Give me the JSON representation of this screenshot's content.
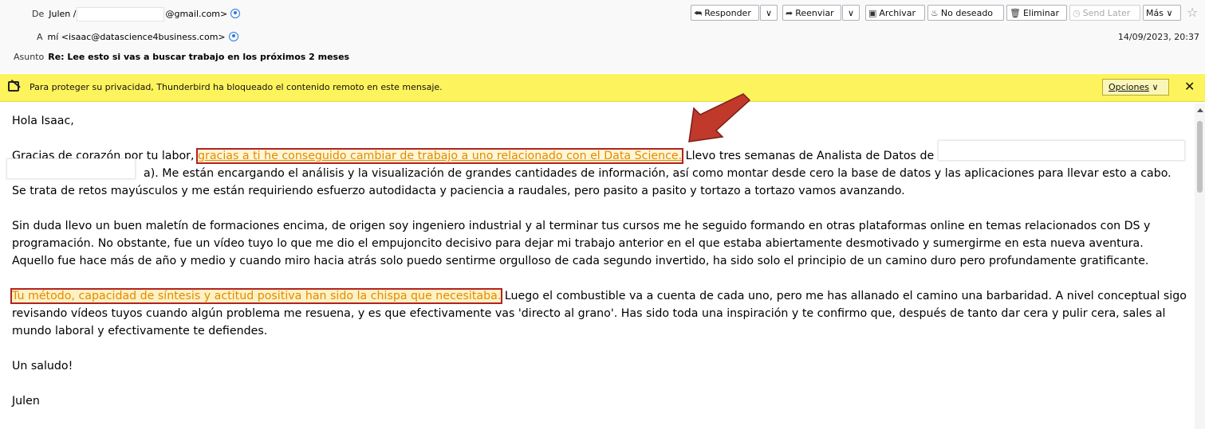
{
  "header": {
    "from_label": "De",
    "from_name": "Julen /",
    "from_email_tail": "@gmail.com>",
    "to_label": "A",
    "to_value": "mí <isaac@datascience4business.com>",
    "subject_label": "Asunto",
    "subject": "Re: Lee esto si vas a buscar trabajo en los próximos 2 meses",
    "date": "14/09/2023, 20:37"
  },
  "toolbar": {
    "reply_label": "Responder",
    "forward_label": "Reenviar",
    "archive_label": "Archivar",
    "junk_label": "No deseado",
    "delete_label": "Eliminar",
    "send_later_label": "Send Later",
    "more_label": "Más"
  },
  "notice": {
    "text": "Para proteger su privacidad, Thunderbird ha bloqueado el contenido remoto en este mensaje.",
    "options_label": "Opciones",
    "close_label": "✕"
  },
  "body": {
    "greeting": "Hola Isaac,",
    "p1_start": "Gracias de corazón por tu labor, ",
    "p1_highlight": "gracias a ti he conseguido cambiar de trabajo a uno relacionado con el Data Science.",
    "p1_mid": " Llevo tres semanas de Analista de Datos de ",
    "p1_visible_after_redact": "a). Me están encargando el análisis y la visualización de grandes cantidades de información, así como montar desde cero la base de datos y las aplicaciones para llevar esto a cabo. Se trata de retos mayúsculos y me están requiriendo esfuerzo autodidacta y paciencia a raudales, pero pasito a pasito y tortazo a tortazo vamos avanzando.",
    "p2": "Sin duda llevo un buen maletín de formaciones encima, de origen soy ingeniero industrial y al terminar tus cursos me he seguido formando en otras plataformas online en temas relacionados con DS y programación. No obstante, fue un vídeo tuyo lo que me dio el empujoncito decisivo para dejar mi trabajo anterior en el que estaba abiertamente desmotivado y sumergirme en esta nueva aventura. Aquello fue hace más de año y medio y cuando miro hacia atrás solo puedo sentirme orgulloso de cada segundo invertido, ha sido solo el principio de un camino duro pero profundamente gratificante.",
    "p3_highlight": "Tu método, capacidad de síntesis y actitud positiva han sido la chispa que necesitaba.",
    "p3_rest": " Luego el combustible va a cuenta de cada uno, pero me has allanado el camino una barbaridad. A nivel conceptual sigo revisando vídeos tuyos cuando algún problema me resuena, y es que efectivamente vas 'directo al grano'. Has sido toda una inspiración y te confirmo que, después de tanto dar cera y pulir cera, sales al mundo laboral y efectivamente te defiendes.",
    "closing": "Un saludo!",
    "signature": "Julen"
  },
  "colors": {
    "notice_bg": "#fdf35c",
    "highlight_text": "#e58a00",
    "highlight_border": "#b22222",
    "arrow": "#c0392b"
  },
  "icons": [
    "contact-icon",
    "reply-icon",
    "forward-icon",
    "archive-icon",
    "junk-icon",
    "trash-icon",
    "send-later-icon",
    "star-icon",
    "remote-content-blocked-icon",
    "close-icon",
    "chevron-down-icon"
  ]
}
